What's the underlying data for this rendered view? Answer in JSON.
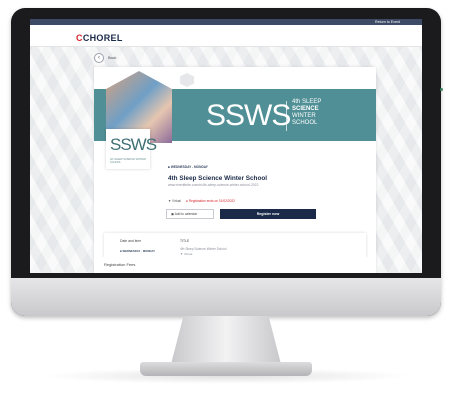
{
  "topbar": {
    "link": "Return to Event"
  },
  "header": {
    "logo_mark": "C",
    "logo_text": "CHOREL"
  },
  "nav": {
    "back_label": "Back"
  },
  "banner": {
    "logo": "SSWS",
    "text_line1": "4th SLEEP",
    "text_line2": "SCIENCE",
    "text_line3": "WINTER",
    "text_line4": "SCHOOL"
  },
  "logo_box": {
    "main": "SSWS",
    "sub": "4th SLEEP SCIENCE WINTER SCHOOL"
  },
  "event": {
    "date_tag": "WEDNESDAY - MONDAY",
    "title": "4th Sleep Science Winter School",
    "url": "www.eventbrite.com/e/4th-sleep-science-winter-school-2022",
    "online": "Virtual",
    "registration": "Registration ends on 01/02/2022",
    "add_calendar": "Add to calendar",
    "register": "Register now"
  },
  "details": {
    "label_date": "Date and time",
    "label_title": "TITLE",
    "date": "WEDNESDAY - MONDAY",
    "title": "4th Sleep Science Winter School",
    "virtual": "Virtual"
  },
  "fees": {
    "label": "Registration Fees"
  },
  "colors": {
    "banner": "#4f8f95",
    "navy": "#1b2a48",
    "accent": "#d7262d"
  }
}
